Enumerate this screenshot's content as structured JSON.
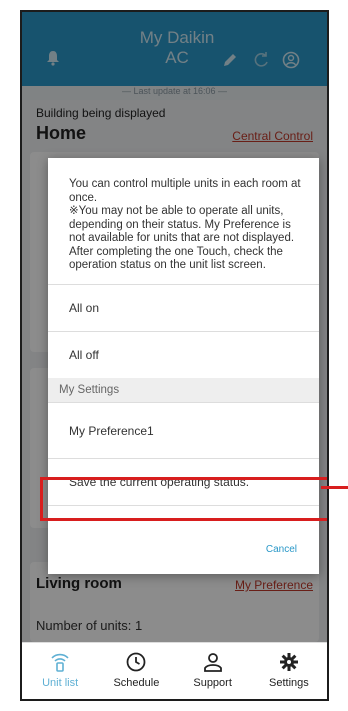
{
  "header": {
    "title_line1": "My Daikin",
    "title_line2": "AC"
  },
  "last_update": "— Last update at 16:06 —",
  "background": {
    "building_label": "Building being displayed",
    "building_name": "Home",
    "central_control": "Central Control",
    "room_name": "Living room",
    "room_preference": "My Preference",
    "units_count": "Number of units:  1"
  },
  "dialog": {
    "message": "You can control multiple units in each room at once.\n※You may not be able to operate all units, depending on their status. My Preference is not available for units that are not displayed. After completing the one Touch, check the operation status on the unit list screen.",
    "all_on": "All on",
    "all_off": "All off",
    "section_label": "My Settings",
    "preference1": "My Preference1",
    "save_status": "Save the current operating status.",
    "cancel": "Cancel"
  },
  "bottom_nav": {
    "unit_list": "Unit list",
    "schedule": "Schedule",
    "support": "Support",
    "settings": "Settings"
  },
  "colors": {
    "header_blue": "#2a98c8",
    "highlight_red": "#d81e1e",
    "link_red": "#c0392b"
  }
}
